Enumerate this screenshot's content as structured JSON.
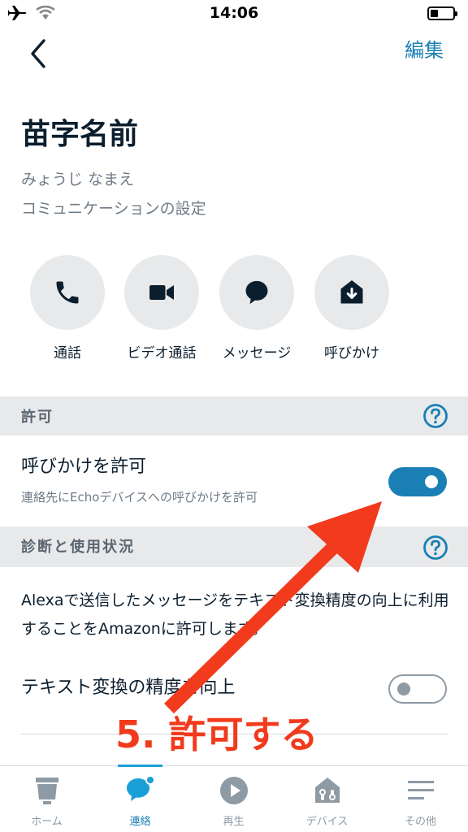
{
  "status_bar": {
    "time": "14:06"
  },
  "header": {
    "edit_label": "編集"
  },
  "contact": {
    "name": "苗字名前",
    "reading": "みょうじ なまえ",
    "settings_label": "コミュニケーションの設定"
  },
  "actions": [
    {
      "label": "通話",
      "icon": "phone-icon"
    },
    {
      "label": "ビデオ通話",
      "icon": "video-camera-icon"
    },
    {
      "label": "メッセージ",
      "icon": "message-bubble-icon"
    },
    {
      "label": "呼びかけ",
      "icon": "drop-in-icon"
    }
  ],
  "permissions": {
    "section_title": "許可",
    "drop_in_title": "呼びかけを許可",
    "drop_in_subtitle": "連絡先にEchoデバイスへの呼びかけを許可",
    "drop_in_enabled": true
  },
  "diagnostics": {
    "section_title": "診断と使用状況",
    "description": "Alexaで送信したメッセージをテキスト変換精度の向上に利用することをAmazonに許可します。",
    "accuracy_title": "テキスト変換の精度を向上",
    "accuracy_enabled": false
  },
  "annotation": {
    "text": "5. 許可する"
  },
  "tab_bar": {
    "active": "連絡",
    "tabs": [
      {
        "label": "ホーム",
        "icon": "home-icon"
      },
      {
        "label": "連絡",
        "icon": "communicate-icon"
      },
      {
        "label": "再生",
        "icon": "play-icon"
      },
      {
        "label": "デバイス",
        "icon": "devices-icon"
      },
      {
        "label": "その他",
        "icon": "menu-icon"
      }
    ]
  },
  "colors": {
    "accent": "#1a7fb5",
    "annotation": "#f23a1c",
    "section_bg": "#e8e9ea"
  }
}
